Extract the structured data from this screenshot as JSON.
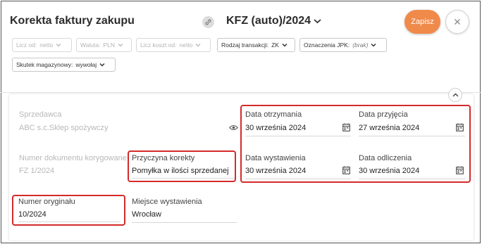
{
  "header": {
    "title": "Korekta faktury zakupu",
    "doc_type": "KFZ (auto)/2024",
    "save_label": "Zapisz"
  },
  "filters": [
    {
      "label": "Licz od:",
      "value": "netto",
      "enabled": false
    },
    {
      "label": "Waluta:",
      "value": "PLN",
      "enabled": false
    },
    {
      "label": "Licz koszt od:",
      "value": "netto",
      "enabled": false
    },
    {
      "label": "Rodzaj transakcji:",
      "value": "ZK",
      "enabled": true
    },
    {
      "label": "Oznaczenia JPK:",
      "value": "(brak)",
      "enabled": true
    },
    {
      "label": "Skutek magazynowy:",
      "value": "wywołaj",
      "enabled": true
    }
  ],
  "form": {
    "seller_label": "Sprzedawca",
    "seller_value": "ABC s.c.Sklep spożywczy",
    "corr_doc_label": "Numer dokumentu korygowanego",
    "corr_doc_value": "FZ 1/2024",
    "reason_label": "Przyczyna korekty",
    "reason_value": "Pomyłka w ilości sprzedanej",
    "original_no_label": "Numer oryginału",
    "original_no_value": "10/2024",
    "place_label": "Miejsce wystawienia",
    "place_value": "Wrocław",
    "received_label": "Data otrzymania",
    "received_value": "30 września 2024",
    "accepted_label": "Data przyjęcia",
    "accepted_value": "27 września 2024",
    "issued_label": "Data wystawienia",
    "issued_value": "30 września 2024",
    "deduction_label": "Data odliczenia",
    "deduction_value": "30 września 2024"
  },
  "colors": {
    "accent": "#f08a4b",
    "highlight": "#d42a2a"
  }
}
